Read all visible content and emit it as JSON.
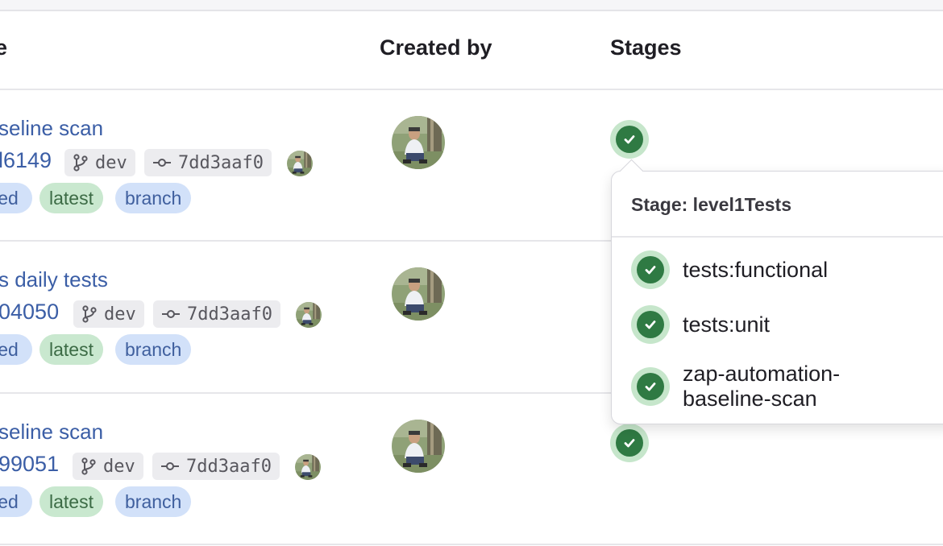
{
  "header": {
    "col_name_partial": "e",
    "created_by": "Created by",
    "stages": "Stages"
  },
  "rows": [
    {
      "title": "seline scan",
      "pipeline_id": "l6149",
      "branch": "dev",
      "commit": "7dd3aaf0",
      "badges": [
        "ed",
        "latest",
        "branch"
      ],
      "stage_status": "passed"
    },
    {
      "title": "s daily tests",
      "pipeline_id": "04050",
      "branch": "dev",
      "commit": "7dd3aaf0",
      "badges": [
        "ed",
        "latest",
        "branch"
      ],
      "stage_status": "passed"
    },
    {
      "title": "seline scan",
      "pipeline_id": "99051",
      "branch": "dev",
      "commit": "7dd3aaf0",
      "badges": [
        "ed",
        "latest",
        "branch"
      ],
      "stage_status": "passed"
    }
  ],
  "popover": {
    "title": "Stage: level1Tests",
    "jobs": [
      {
        "name": "tests:functional",
        "status": "passed"
      },
      {
        "name": "tests:unit",
        "status": "passed"
      },
      {
        "name": "zap-automation-baseline-scan",
        "status": "passed"
      }
    ]
  },
  "colors": {
    "link": "#3b5ea6",
    "success": "#2f7a43",
    "success_bg": "#c6e6cb",
    "badge_blue": "#d2e1f9",
    "badge_green": "#c9e8cf"
  },
  "icons": {
    "branch": "git-branch-icon",
    "commit": "git-commit-icon",
    "status": "check-circle-icon"
  }
}
